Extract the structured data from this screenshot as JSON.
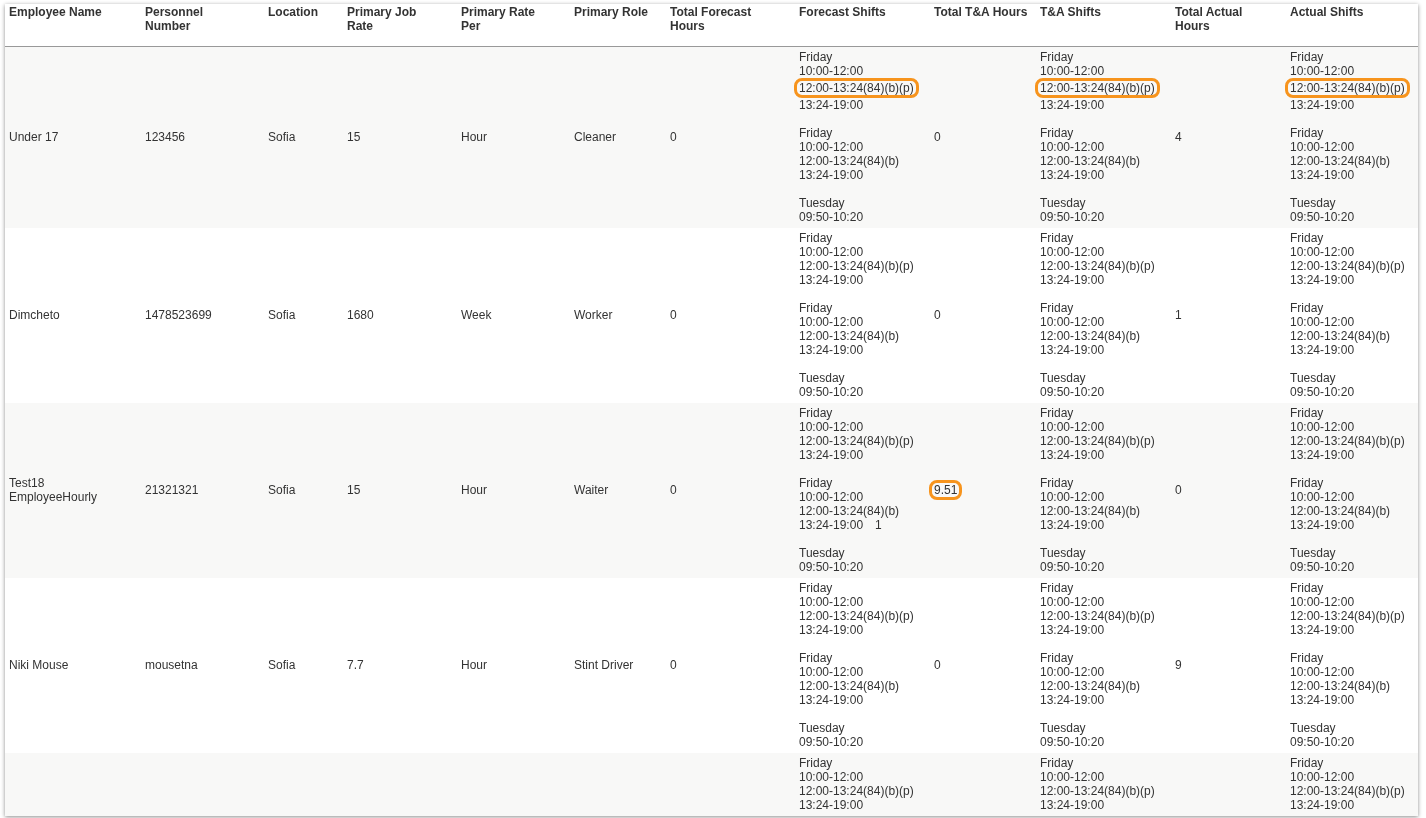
{
  "table": {
    "columns": [
      "Employee Name",
      "Personnel Number",
      "Location",
      "Primary Job Rate",
      "Primary Rate Per",
      "Primary Role",
      "Total Forecast Hours",
      "Forecast Shifts",
      "Total T&A Hours",
      "T&A Shifts",
      "Total Actual Hours",
      "Actual Shifts"
    ],
    "rows": [
      {
        "employee_name": "Under 17",
        "personnel_number": "123456",
        "location": "Sofia",
        "primary_job_rate": "15",
        "primary_rate_per": "Hour",
        "primary_role": "Cleaner",
        "total_forecast_hours": "0",
        "total_ta_hours": "0",
        "total_ta_highlighted": false,
        "total_actual_hours": "4",
        "forecast_shifts": [
          {
            "day": "Friday",
            "times": [
              {
                "text": "10:00-12:00",
                "highlighted": false
              },
              {
                "text": "12:00-13:24(84)(b)(p)",
                "highlighted": true
              },
              {
                "text": "13:24-19:00",
                "highlighted": false
              }
            ]
          },
          {
            "day": "Friday",
            "times": [
              {
                "text": "10:00-12:00",
                "highlighted": false
              },
              {
                "text": "12:00-13:24(84)(b)",
                "highlighted": false
              },
              {
                "text": "13:24-19:00",
                "highlighted": false
              }
            ]
          },
          {
            "day": "Tuesday",
            "times": [
              {
                "text": "09:50-10:20",
                "highlighted": false
              }
            ]
          }
        ],
        "ta_shifts": [
          {
            "day": "Friday",
            "times": [
              {
                "text": "10:00-12:00",
                "highlighted": false
              },
              {
                "text": "12:00-13:24(84)(b)(p)",
                "highlighted": true
              },
              {
                "text": "13:24-19:00",
                "highlighted": false
              }
            ]
          },
          {
            "day": "Friday",
            "times": [
              {
                "text": "10:00-12:00",
                "highlighted": false
              },
              {
                "text": "12:00-13:24(84)(b)",
                "highlighted": false
              },
              {
                "text": "13:24-19:00",
                "highlighted": false
              }
            ]
          },
          {
            "day": "Tuesday",
            "times": [
              {
                "text": "09:50-10:20",
                "highlighted": false
              }
            ]
          }
        ],
        "actual_shifts": [
          {
            "day": "Friday",
            "times": [
              {
                "text": "10:00-12:00",
                "highlighted": false
              },
              {
                "text": "12:00-13:24(84)(b)(p)",
                "highlighted": true
              },
              {
                "text": "13:24-19:00",
                "highlighted": false
              }
            ]
          },
          {
            "day": "Friday",
            "times": [
              {
                "text": "10:00-12:00",
                "highlighted": false
              },
              {
                "text": "12:00-13:24(84)(b)",
                "highlighted": false
              },
              {
                "text": "13:24-19:00",
                "highlighted": false
              }
            ]
          },
          {
            "day": "Tuesday",
            "times": [
              {
                "text": "09:50-10:20",
                "highlighted": false
              }
            ]
          }
        ]
      },
      {
        "employee_name": "Dimcheto",
        "personnel_number": "1478523699",
        "location": "Sofia",
        "primary_job_rate": "1680",
        "primary_rate_per": "Week",
        "primary_role": "Worker",
        "total_forecast_hours": "0",
        "total_ta_hours": "0",
        "total_ta_highlighted": false,
        "total_actual_hours": "1",
        "forecast_shifts": [
          {
            "day": "Friday",
            "times": [
              {
                "text": "10:00-12:00",
                "highlighted": false
              },
              {
                "text": "12:00-13:24(84)(b)(p)",
                "highlighted": false
              },
              {
                "text": "13:24-19:00",
                "highlighted": false
              }
            ]
          },
          {
            "day": "Friday",
            "times": [
              {
                "text": "10:00-12:00",
                "highlighted": false
              },
              {
                "text": "12:00-13:24(84)(b)",
                "highlighted": false
              },
              {
                "text": "13:24-19:00",
                "highlighted": false
              }
            ]
          },
          {
            "day": "Tuesday",
            "times": [
              {
                "text": "09:50-10:20",
                "highlighted": false
              }
            ]
          }
        ],
        "ta_shifts": [
          {
            "day": "Friday",
            "times": [
              {
                "text": "10:00-12:00",
                "highlighted": false
              },
              {
                "text": "12:00-13:24(84)(b)(p)",
                "highlighted": false
              },
              {
                "text": "13:24-19:00",
                "highlighted": false
              }
            ]
          },
          {
            "day": "Friday",
            "times": [
              {
                "text": "10:00-12:00",
                "highlighted": false
              },
              {
                "text": "12:00-13:24(84)(b)",
                "highlighted": false
              },
              {
                "text": "13:24-19:00",
                "highlighted": false
              }
            ]
          },
          {
            "day": "Tuesday",
            "times": [
              {
                "text": "09:50-10:20",
                "highlighted": false
              }
            ]
          }
        ],
        "actual_shifts": [
          {
            "day": "Friday",
            "times": [
              {
                "text": "10:00-12:00",
                "highlighted": false
              },
              {
                "text": "12:00-13:24(84)(b)(p)",
                "highlighted": false
              },
              {
                "text": "13:24-19:00",
                "highlighted": false
              }
            ]
          },
          {
            "day": "Friday",
            "times": [
              {
                "text": "10:00-12:00",
                "highlighted": false
              },
              {
                "text": "12:00-13:24(84)(b)",
                "highlighted": false
              },
              {
                "text": "13:24-19:00",
                "highlighted": false
              }
            ]
          },
          {
            "day": "Tuesday",
            "times": [
              {
                "text": "09:50-10:20",
                "highlighted": false
              }
            ]
          }
        ]
      },
      {
        "employee_name": "Test18 EmployeeHourly",
        "personnel_number": "21321321",
        "location": "Sofia",
        "primary_job_rate": "15",
        "primary_rate_per": "Hour",
        "primary_role": "Waiter",
        "total_forecast_hours": "0",
        "total_ta_hours": "9.51",
        "total_ta_highlighted": true,
        "total_actual_hours": "0",
        "forecast_shifts": [
          {
            "day": "Friday",
            "times": [
              {
                "text": "10:00-12:00",
                "highlighted": false
              },
              {
                "text": "12:00-13:24(84)(b)(p)",
                "highlighted": false
              },
              {
                "text": "13:24-19:00",
                "highlighted": false
              }
            ]
          },
          {
            "day": "Friday",
            "times": [
              {
                "text": "10:00-12:00",
                "highlighted": false
              },
              {
                "text": "12:00-13:24(84)(b)",
                "highlighted": false
              },
              {
                "text": "13:24-19:00",
                "highlighted": false
              }
            ],
            "note": "1"
          },
          {
            "day": "Tuesday",
            "times": [
              {
                "text": "09:50-10:20",
                "highlighted": false
              }
            ]
          }
        ],
        "ta_shifts": [
          {
            "day": "Friday",
            "times": [
              {
                "text": "10:00-12:00",
                "highlighted": false
              },
              {
                "text": "12:00-13:24(84)(b)(p)",
                "highlighted": false
              },
              {
                "text": "13:24-19:00",
                "highlighted": false
              }
            ]
          },
          {
            "day": "Friday",
            "times": [
              {
                "text": "10:00-12:00",
                "highlighted": false
              },
              {
                "text": "12:00-13:24(84)(b)",
                "highlighted": false
              },
              {
                "text": "13:24-19:00",
                "highlighted": false
              }
            ]
          },
          {
            "day": "Tuesday",
            "times": [
              {
                "text": "09:50-10:20",
                "highlighted": false
              }
            ]
          }
        ],
        "actual_shifts": [
          {
            "day": "Friday",
            "times": [
              {
                "text": "10:00-12:00",
                "highlighted": false
              },
              {
                "text": "12:00-13:24(84)(b)(p)",
                "highlighted": false
              },
              {
                "text": "13:24-19:00",
                "highlighted": false
              }
            ]
          },
          {
            "day": "Friday",
            "times": [
              {
                "text": "10:00-12:00",
                "highlighted": false
              },
              {
                "text": "12:00-13:24(84)(b)",
                "highlighted": false
              },
              {
                "text": "13:24-19:00",
                "highlighted": false
              }
            ]
          },
          {
            "day": "Tuesday",
            "times": [
              {
                "text": "09:50-10:20",
                "highlighted": false
              }
            ]
          }
        ]
      },
      {
        "employee_name": "Niki Mouse",
        "personnel_number": "mousetna",
        "location": "Sofia",
        "primary_job_rate": "7.7",
        "primary_rate_per": "Hour",
        "primary_role": "Stint Driver",
        "total_forecast_hours": "0",
        "total_ta_hours": "0",
        "total_ta_highlighted": false,
        "total_actual_hours": "9",
        "forecast_shifts": [
          {
            "day": "Friday",
            "times": [
              {
                "text": "10:00-12:00",
                "highlighted": false
              },
              {
                "text": "12:00-13:24(84)(b)(p)",
                "highlighted": false
              },
              {
                "text": "13:24-19:00",
                "highlighted": false
              }
            ]
          },
          {
            "day": "Friday",
            "times": [
              {
                "text": "10:00-12:00",
                "highlighted": false
              },
              {
                "text": "12:00-13:24(84)(b)",
                "highlighted": false
              },
              {
                "text": "13:24-19:00",
                "highlighted": false
              }
            ]
          },
          {
            "day": "Tuesday",
            "times": [
              {
                "text": "09:50-10:20",
                "highlighted": false
              }
            ]
          }
        ],
        "ta_shifts": [
          {
            "day": "Friday",
            "times": [
              {
                "text": "10:00-12:00",
                "highlighted": false
              },
              {
                "text": "12:00-13:24(84)(b)(p)",
                "highlighted": false
              },
              {
                "text": "13:24-19:00",
                "highlighted": false
              }
            ]
          },
          {
            "day": "Friday",
            "times": [
              {
                "text": "10:00-12:00",
                "highlighted": false
              },
              {
                "text": "12:00-13:24(84)(b)",
                "highlighted": false
              },
              {
                "text": "13:24-19:00",
                "highlighted": false
              }
            ]
          },
          {
            "day": "Tuesday",
            "times": [
              {
                "text": "09:50-10:20",
                "highlighted": false
              }
            ]
          }
        ],
        "actual_shifts": [
          {
            "day": "Friday",
            "times": [
              {
                "text": "10:00-12:00",
                "highlighted": false
              },
              {
                "text": "12:00-13:24(84)(b)(p)",
                "highlighted": false
              },
              {
                "text": "13:24-19:00",
                "highlighted": false
              }
            ]
          },
          {
            "day": "Friday",
            "times": [
              {
                "text": "10:00-12:00",
                "highlighted": false
              },
              {
                "text": "12:00-13:24(84)(b)",
                "highlighted": false
              },
              {
                "text": "13:24-19:00",
                "highlighted": false
              }
            ]
          },
          {
            "day": "Tuesday",
            "times": [
              {
                "text": "09:50-10:20",
                "highlighted": false
              }
            ]
          }
        ]
      },
      {
        "forecast_shifts": [
          {
            "day": "Friday",
            "times": [
              {
                "text": "10:00-12:00",
                "highlighted": false
              },
              {
                "text": "12:00-13:24(84)(b)(p)",
                "highlighted": false
              },
              {
                "text": "13:24-19:00",
                "highlighted": false
              }
            ]
          }
        ],
        "ta_shifts": [
          {
            "day": "Friday",
            "times": [
              {
                "text": "10:00-12:00",
                "highlighted": false
              },
              {
                "text": "12:00-13:24(84)(b)(p)",
                "highlighted": false
              },
              {
                "text": "13:24-19:00",
                "highlighted": false
              }
            ]
          }
        ],
        "actual_shifts": [
          {
            "day": "Friday",
            "times": [
              {
                "text": "10:00-12:00",
                "highlighted": false
              },
              {
                "text": "12:00-13:24(84)(b)(p)",
                "highlighted": false
              },
              {
                "text": "13:24-19:00",
                "highlighted": false
              }
            ]
          }
        ]
      }
    ]
  }
}
